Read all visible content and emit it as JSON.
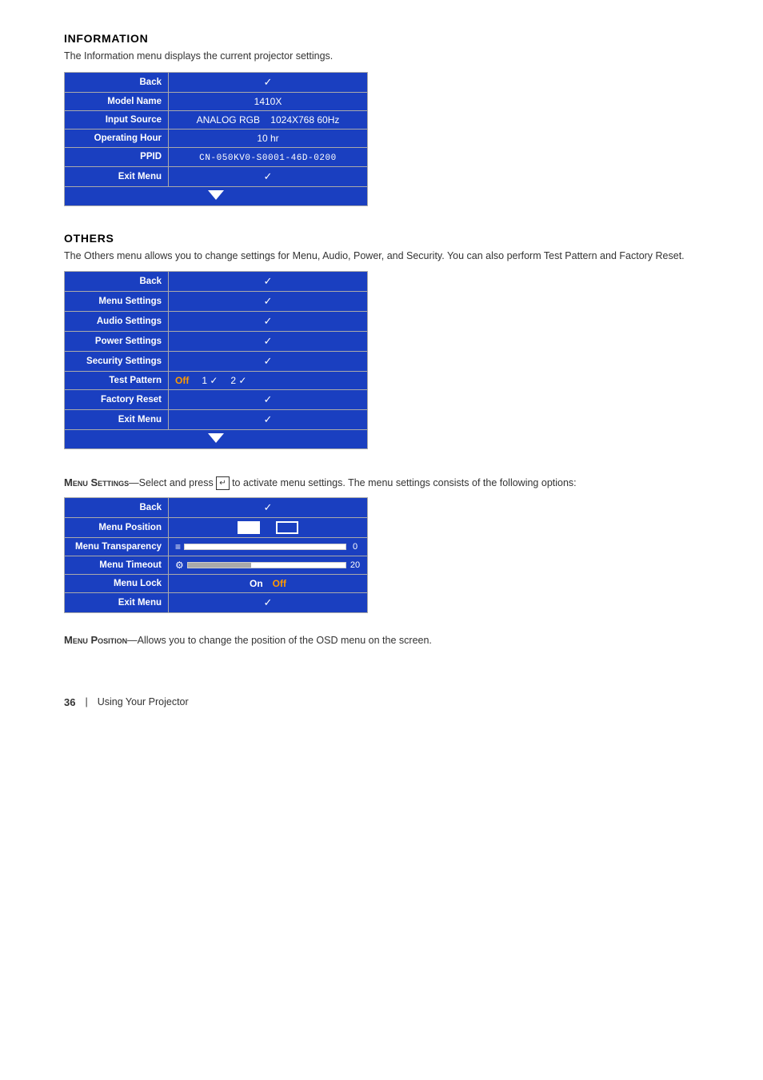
{
  "information": {
    "title": "INFORMATION",
    "description": "The Information menu displays the current projector settings.",
    "rows": [
      {
        "label": "Back",
        "value": "✓",
        "type": "check"
      },
      {
        "label": "Model Name",
        "value": "1410X",
        "type": "text"
      },
      {
        "label": "Input Source",
        "value": "ANALOG RGB    1024X768 60Hz",
        "type": "text"
      },
      {
        "label": "Operating Hour",
        "value": "10 hr",
        "type": "text"
      },
      {
        "label": "PPID",
        "value": "CN-050KV0-S0001-46D-0200",
        "type": "ppid"
      },
      {
        "label": "Exit Menu",
        "value": "✓",
        "type": "check"
      }
    ]
  },
  "others": {
    "title": "OTHERS",
    "description": "The Others menu allows you to change settings for Menu, Audio, Power, and Security. You can also perform Test Pattern and Factory Reset.",
    "rows": [
      {
        "label": "Back",
        "value": "✓"
      },
      {
        "label": "Menu Settings",
        "value": "✓"
      },
      {
        "label": "Audio Settings",
        "value": "✓"
      },
      {
        "label": "Power Settings",
        "value": "✓"
      },
      {
        "label": "Security Settings",
        "value": "✓"
      },
      {
        "label": "Test Pattern",
        "value_off": "Off",
        "value_1": "1 ✓",
        "value_2": "2 ✓",
        "type": "test"
      },
      {
        "label": "Factory Reset",
        "value": "✓"
      },
      {
        "label": "Exit Menu",
        "value": "✓"
      }
    ]
  },
  "menu_settings": {
    "intro": "Menu Settings",
    "intro_dash": "—Select and press",
    "intro_cont": "to activate menu settings. The menu settings consists of the following options:",
    "rows": [
      {
        "label": "Back",
        "value": "✓",
        "type": "check"
      },
      {
        "label": "Menu Position",
        "type": "position"
      },
      {
        "label": "Menu Transparency",
        "type": "slider",
        "value": "0"
      },
      {
        "label": "Menu Timeout",
        "type": "slider",
        "value": "20"
      },
      {
        "label": "Menu Lock",
        "type": "onoff",
        "on": "On",
        "off": "Off"
      },
      {
        "label": "Exit Menu",
        "value": "✓",
        "type": "check"
      }
    ]
  },
  "menu_position": {
    "title": "Menu Position",
    "dash": "—",
    "desc": "Allows you to change the position of the OSD menu on the screen."
  },
  "page_footer": {
    "number": "36",
    "separator": "|",
    "text": "Using Your Projector"
  }
}
